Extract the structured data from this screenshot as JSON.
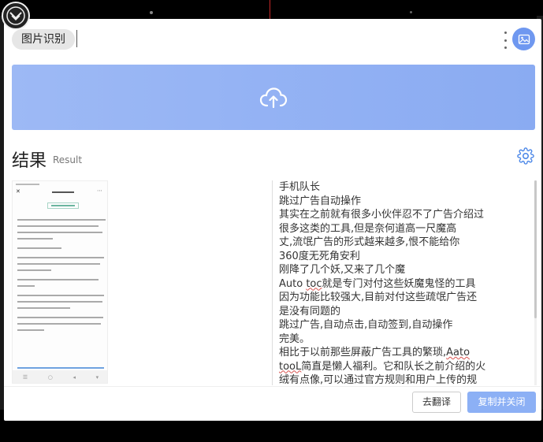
{
  "header": {
    "title": "图片识别"
  },
  "upload": {
    "icon": "cloud-upload-icon"
  },
  "result": {
    "title": "结果",
    "subtitle": "Result"
  },
  "preview": {
    "icon": "document-thumbnail"
  },
  "ocr_lines": [
    "手机队长",
    "跳过广告自动操作",
    "其实在之前就有很多小伙伴忍不了广告介绍过",
    "很多这类的工具,但是奈何道高一尺魔高",
    "丈,流氓广告的形式越来越多,恨不能给你",
    "360度无死角安利",
    "刚降了几个妖,又来了几个魔",
    "Auto toc就是专门对付这些妖魔鬼怪的工具",
    "因为功能比较强大,目前对付这些疏氓广告还",
    "是没有同题的",
    "跳过广告,自动点击,自动签到,自动操作",
    "完美。",
    "相比于以前那些屏蔽广告工具的繁琐,Aato",
    "tooL简直是懒人福利。它和队长之前介绍的火",
    "绒有点像,可以通过官方规则和用户上传的规"
  ],
  "footer": {
    "translate_label": "去翻译",
    "copy_close_label": "复制并关闭"
  },
  "colors": {
    "accent": "#8aabf2",
    "avatar": "#6f98f0",
    "button_primary": "#8cb0f5"
  }
}
